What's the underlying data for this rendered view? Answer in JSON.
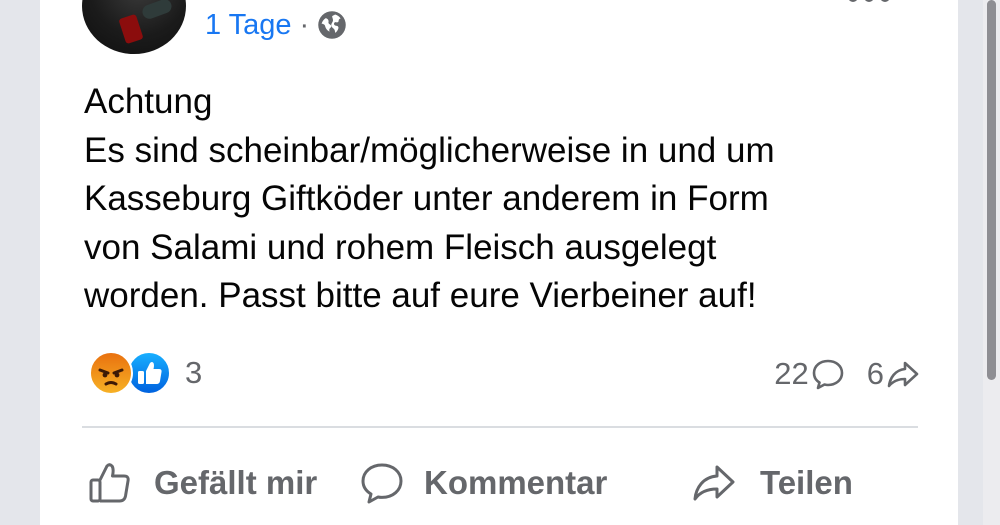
{
  "post": {
    "time": "1 Tage",
    "separator": "·",
    "visibility_icon": "globe-icon",
    "text_lines": [
      "Achtung",
      "Es sind scheinbar/möglicherweise in und um",
      "Kasseburg Giftköder unter anderem in Form",
      "von Salami und rohem Fleisch ausgelegt",
      "worden. Passt bitte auf eure Vierbeiner auf!"
    ]
  },
  "reactions": {
    "icons": [
      "angry-reaction-icon",
      "like-reaction-icon"
    ],
    "count": "3"
  },
  "stats": {
    "comments": "22",
    "shares": "6"
  },
  "actions": {
    "like": "Gefällt mir",
    "comment": "Kommentar",
    "share": "Teilen"
  },
  "colors": {
    "link_blue": "#1877f2",
    "secondary_text": "#65676b",
    "primary_text": "#050505",
    "divider": "#dadde1"
  }
}
